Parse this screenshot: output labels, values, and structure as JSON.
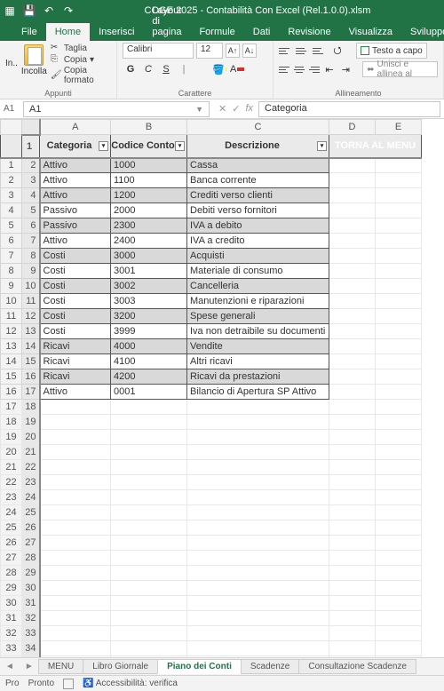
{
  "titlebar": {
    "doc_title": "COGE 2025 - Contabilità Con Excel (Rel.1.0.0).xlsm"
  },
  "tabs": {
    "file": "File",
    "home": "Home",
    "insert": "Inserisci",
    "layout": "Layout di pagina",
    "formulas": "Formule",
    "data": "Dati",
    "review": "Revisione",
    "view": "Visualizza",
    "dev": "Sviluppo"
  },
  "ribbon": {
    "clipboard": {
      "paste": "Incolla",
      "cut": "Taglia",
      "copy": "Copia",
      "format_painter": "Copia formato",
      "group": "Appunti"
    },
    "font": {
      "name": "Calibri",
      "size": "12",
      "bold": "G",
      "italic": "C",
      "under": "S",
      "group": "Carattere"
    },
    "align": {
      "wrap": "Testo a capo",
      "merge": "Unisci e allinea al",
      "group": "Allineamento"
    }
  },
  "namebox": {
    "outer": "A1",
    "value": "A1"
  },
  "formula": {
    "value": "Categoria"
  },
  "columns": [
    "A",
    "B",
    "C",
    "D",
    "E"
  ],
  "header_row": {
    "cat": "Categoria",
    "code": "Codice Conto",
    "desc": "Descrizione"
  },
  "menu_button": "TORNA AL MENU",
  "rows": [
    {
      "n": "2",
      "cat": "Attivo",
      "code": "1000",
      "desc": "Cassa",
      "shade": true
    },
    {
      "n": "3",
      "cat": "Attivo",
      "code": "1100",
      "desc": "Banca corrente",
      "shade": false
    },
    {
      "n": "4",
      "cat": "Attivo",
      "code": "1200",
      "desc": "Crediti verso clienti",
      "shade": true
    },
    {
      "n": "5",
      "cat": "Passivo",
      "code": "2000",
      "desc": "Debiti verso fornitori",
      "shade": false
    },
    {
      "n": "6",
      "cat": "Passivo",
      "code": "2300",
      "desc": "IVA a debito",
      "shade": true
    },
    {
      "n": "7",
      "cat": "Attivo",
      "code": "2400",
      "desc": "IVA a credito",
      "shade": false
    },
    {
      "n": "8",
      "cat": "Costi",
      "code": "3000",
      "desc": "Acquisti",
      "shade": true
    },
    {
      "n": "9",
      "cat": "Costi",
      "code": "3001",
      "desc": "Materiale di consumo",
      "shade": false
    },
    {
      "n": "10",
      "cat": "Costi",
      "code": "3002",
      "desc": "Cancelleria",
      "shade": true
    },
    {
      "n": "11",
      "cat": "Costi",
      "code": "3003",
      "desc": "Manutenzioni e riparazioni",
      "shade": false
    },
    {
      "n": "12",
      "cat": "Costi",
      "code": "3200",
      "desc": "Spese generali",
      "shade": true
    },
    {
      "n": "13",
      "cat": "Costi",
      "code": "3999",
      "desc": "Iva non detraibile su documenti",
      "shade": false
    },
    {
      "n": "14",
      "cat": "Ricavi",
      "code": "4000",
      "desc": "Vendite",
      "shade": true
    },
    {
      "n": "15",
      "cat": "Ricavi",
      "code": "4100",
      "desc": "Altri ricavi",
      "shade": false
    },
    {
      "n": "16",
      "cat": "Ricavi",
      "code": "4200",
      "desc": "Ricavi da prestazioni",
      "shade": true
    },
    {
      "n": "17",
      "cat": "Attivo",
      "code": "0001",
      "desc": "Bilancio di Apertura SP Attivo",
      "shade": false
    }
  ],
  "sheets": {
    "menu": "MENU",
    "libro": "Libro Giornale",
    "piano": "Piano dei Conti",
    "scad": "Scadenze",
    "cons": "Consultazione Scadenze"
  },
  "status": {
    "pro": "Pro",
    "ready": "Pronto",
    "access": "Accessibilità: verifica"
  }
}
